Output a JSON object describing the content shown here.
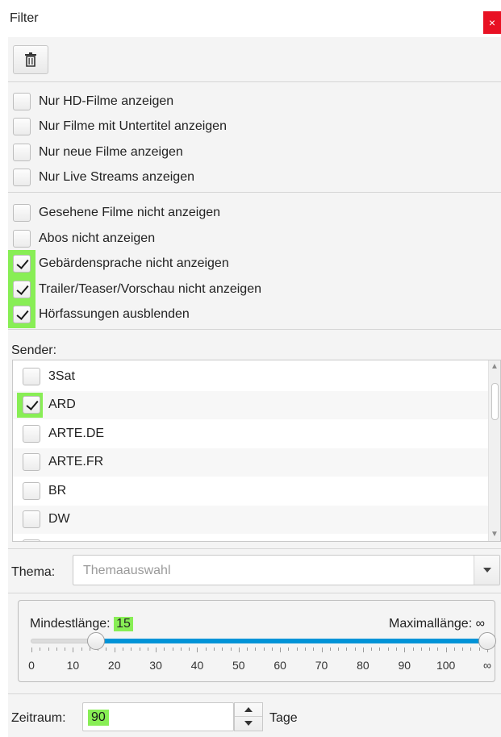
{
  "window": {
    "title": "Filter",
    "close_glyph": "×",
    "close_icon": "close-icon"
  },
  "toolbar": {
    "delete_icon": "trash-icon"
  },
  "group1": [
    {
      "label": "Nur HD-Filme anzeigen",
      "checked": false
    },
    {
      "label": "Nur Filme mit Untertitel anzeigen",
      "checked": false
    },
    {
      "label": "Nur neue Filme anzeigen",
      "checked": false
    },
    {
      "label": "Nur Live Streams anzeigen",
      "checked": false
    }
  ],
  "group2": [
    {
      "label": "Gesehene Filme nicht anzeigen",
      "checked": false
    },
    {
      "label": "Abos nicht anzeigen",
      "checked": false
    },
    {
      "label": "Gebärdensprache nicht anzeigen",
      "checked": true
    },
    {
      "label": "Trailer/Teaser/Vorschau nicht anzeigen",
      "checked": true
    },
    {
      "label": "Hörfassungen ausblenden",
      "checked": true
    }
  ],
  "sender": {
    "label": "Sender:",
    "items": [
      {
        "label": "3Sat",
        "checked": false
      },
      {
        "label": "ARD",
        "checked": true
      },
      {
        "label": "ARTE.DE",
        "checked": false
      },
      {
        "label": "ARTE.FR",
        "checked": false
      },
      {
        "label": "BR",
        "checked": false
      },
      {
        "label": "DW",
        "checked": false
      },
      {
        "label": "HR",
        "checked": false
      }
    ]
  },
  "thema": {
    "label": "Thema:",
    "placeholder": "Themaauswahl"
  },
  "length_slider": {
    "min_label": "Mindestlänge:",
    "min_value": "15",
    "max_label": "Maximallänge: ∞",
    "tick_labels": [
      "0",
      "10",
      "20",
      "30",
      "40",
      "50",
      "60",
      "70",
      "80",
      "90",
      "100",
      "∞"
    ],
    "low_value": 15,
    "high_value": "∞"
  },
  "zeitraum": {
    "label": "Zeitraum:",
    "value": "90",
    "unit": "Tage"
  },
  "colors": {
    "highlight": "#88ee55",
    "accent": "#0093d7",
    "close": "#e81123"
  }
}
